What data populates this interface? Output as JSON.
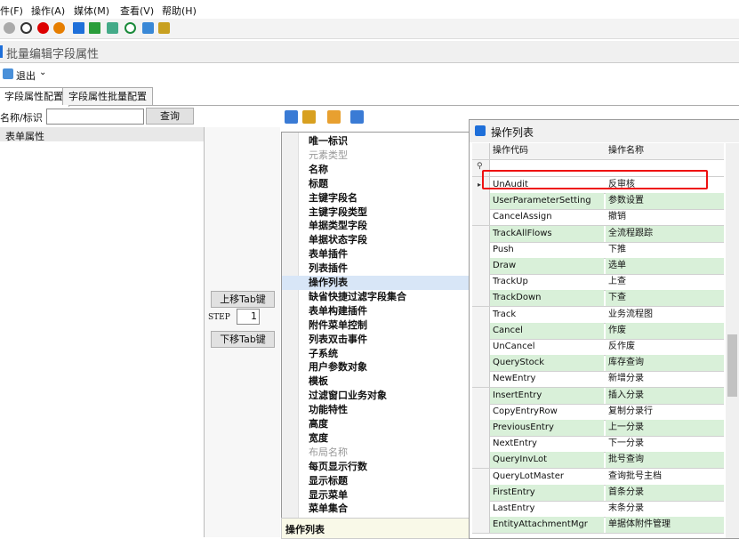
{
  "menu": [
    "件(F)",
    "操作(A)",
    "媒体(M)",
    "查看(V)",
    "帮助(H)"
  ],
  "window_title": "批量编辑字段属性",
  "exit_label": "退出",
  "tabs": [
    "字段属性配置",
    "字段属性批量配置"
  ],
  "search": {
    "label": "名称/标识",
    "value": "",
    "button": "查询"
  },
  "tree_header": "表单属性",
  "mid": {
    "up_button": "上移Tab键",
    "step_label": "STEP",
    "step_value": "1",
    "down_button": "下移Tab键"
  },
  "properties": [
    {
      "label": "唯一标识",
      "gray": false
    },
    {
      "label": "元素类型",
      "gray": true
    },
    {
      "label": "名称",
      "gray": false
    },
    {
      "label": "标题",
      "gray": false
    },
    {
      "label": "主键字段名",
      "gray": false
    },
    {
      "label": "主键字段类型",
      "gray": false
    },
    {
      "label": "单据类型字段",
      "gray": false
    },
    {
      "label": "单据状态字段",
      "gray": false
    },
    {
      "label": "表单插件",
      "gray": false
    },
    {
      "label": "列表插件",
      "gray": false
    },
    {
      "label": "操作列表",
      "gray": false,
      "selected": true
    },
    {
      "label": "缺省快捷过滤字段集合",
      "gray": false
    },
    {
      "label": "表单构建插件",
      "gray": false
    },
    {
      "label": "附件菜单控制",
      "gray": false
    },
    {
      "label": "列表双击事件",
      "gray": false
    },
    {
      "label": "子系统",
      "gray": false
    },
    {
      "label": "用户参数对象",
      "gray": false
    },
    {
      "label": "模板",
      "gray": false
    },
    {
      "label": "过滤窗口业务对象",
      "gray": false
    },
    {
      "label": "功能特性",
      "gray": false
    },
    {
      "label": "高度",
      "gray": false
    },
    {
      "label": "宽度",
      "gray": false
    },
    {
      "label": "布局名称",
      "gray": true
    },
    {
      "label": "每页显示行数",
      "gray": false
    },
    {
      "label": "显示标题",
      "gray": false
    },
    {
      "label": "显示菜单",
      "gray": false
    },
    {
      "label": "菜单集合",
      "gray": false
    }
  ],
  "prop_footer": "操作列表",
  "popup": {
    "title": "操作列表",
    "columns": [
      "操作代码",
      "操作名称"
    ],
    "rows": [
      [
        "UnAudit",
        "反审核"
      ],
      [
        "UserParameterSetting",
        "参数设置"
      ],
      [
        "CancelAssign",
        "撤销"
      ],
      [
        "TrackAllFlows",
        "全流程跟踪"
      ],
      [
        "Push",
        "下推"
      ],
      [
        "Draw",
        "选单"
      ],
      [
        "TrackUp",
        "上查"
      ],
      [
        "TrackDown",
        "下查"
      ],
      [
        "Track",
        "业务流程图"
      ],
      [
        "Cancel",
        "作废"
      ],
      [
        "UnCancel",
        "反作废"
      ],
      [
        "QueryStock",
        "库存查询"
      ],
      [
        "NewEntry",
        "新增分录"
      ],
      [
        "InsertEntry",
        "插入分录"
      ],
      [
        "CopyEntryRow",
        "复制分录行"
      ],
      [
        "PreviousEntry",
        "上一分录"
      ],
      [
        "NextEntry",
        "下一分录"
      ],
      [
        "QueryInvLot",
        "批号查询"
      ],
      [
        "QueryLotMaster",
        "查询批号主档"
      ],
      [
        "FirstEntry",
        "首条分录"
      ],
      [
        "LastEntry",
        "末条分录"
      ],
      [
        "EntityAttachmentMgr",
        "单据体附件管理"
      ]
    ]
  },
  "colors": {
    "accent": "#1e6fd9",
    "highlight_box": "#ee1111",
    "alt_row": "#d9f0d9"
  }
}
